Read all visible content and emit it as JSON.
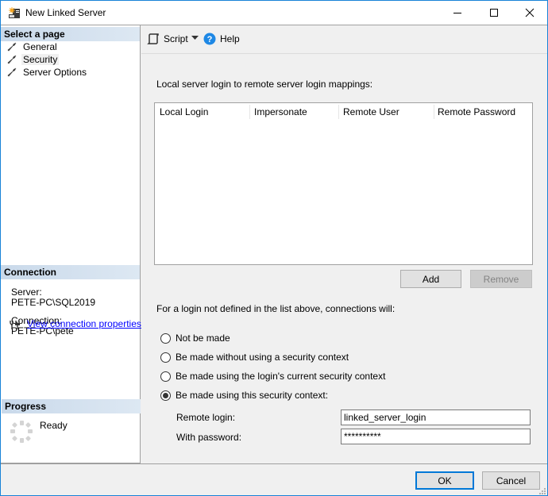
{
  "window": {
    "title": "New Linked Server",
    "controls": {
      "minimize": "minimize-icon",
      "maximize": "maximize-icon",
      "close": "close-icon"
    }
  },
  "left_pane": {
    "select_page_header": "Select a page",
    "pages": [
      {
        "label": "General",
        "icon": "wrench-icon",
        "selected": false
      },
      {
        "label": "Security",
        "icon": "wrench-icon",
        "selected": true
      },
      {
        "label": "Server Options",
        "icon": "wrench-icon",
        "selected": false
      }
    ],
    "connection": {
      "header": "Connection",
      "server_label": "Server:",
      "server_value": "PETE-PC\\SQL2019",
      "connection_label": "Connection:",
      "connection_value": "PETE-PC\\pete",
      "view_properties_link": "View connection properties"
    },
    "progress": {
      "header": "Progress",
      "status": "Ready"
    }
  },
  "toolbar": {
    "script_label": "Script",
    "help_label": "Help"
  },
  "security": {
    "mapping_label": "Local server login to remote server login mappings:",
    "grid_columns": [
      "Local Login",
      "Impersonate",
      "Remote User",
      "Remote Password"
    ],
    "grid_rows": [],
    "add_button": "Add",
    "remove_button": "Remove",
    "login_behavior_label": "For a login not defined in the list above, connections will:",
    "options": [
      {
        "label": "Not be made",
        "checked": false
      },
      {
        "label": "Be made without using a security context",
        "checked": false
      },
      {
        "label": "Be made using the login's current security context",
        "checked": false
      },
      {
        "label": "Be made using this security context:",
        "checked": true
      }
    ],
    "remote_login_label": "Remote login:",
    "remote_login_value": "linked_server_login",
    "password_label": "With password:",
    "password_value": "**********"
  },
  "footer": {
    "ok_button": "OK",
    "cancel_button": "Cancel"
  },
  "colors": {
    "accent": "#0078d7",
    "window_border": "#1883d7",
    "section_header": "#c9d9ea",
    "link": "#0000ff"
  }
}
